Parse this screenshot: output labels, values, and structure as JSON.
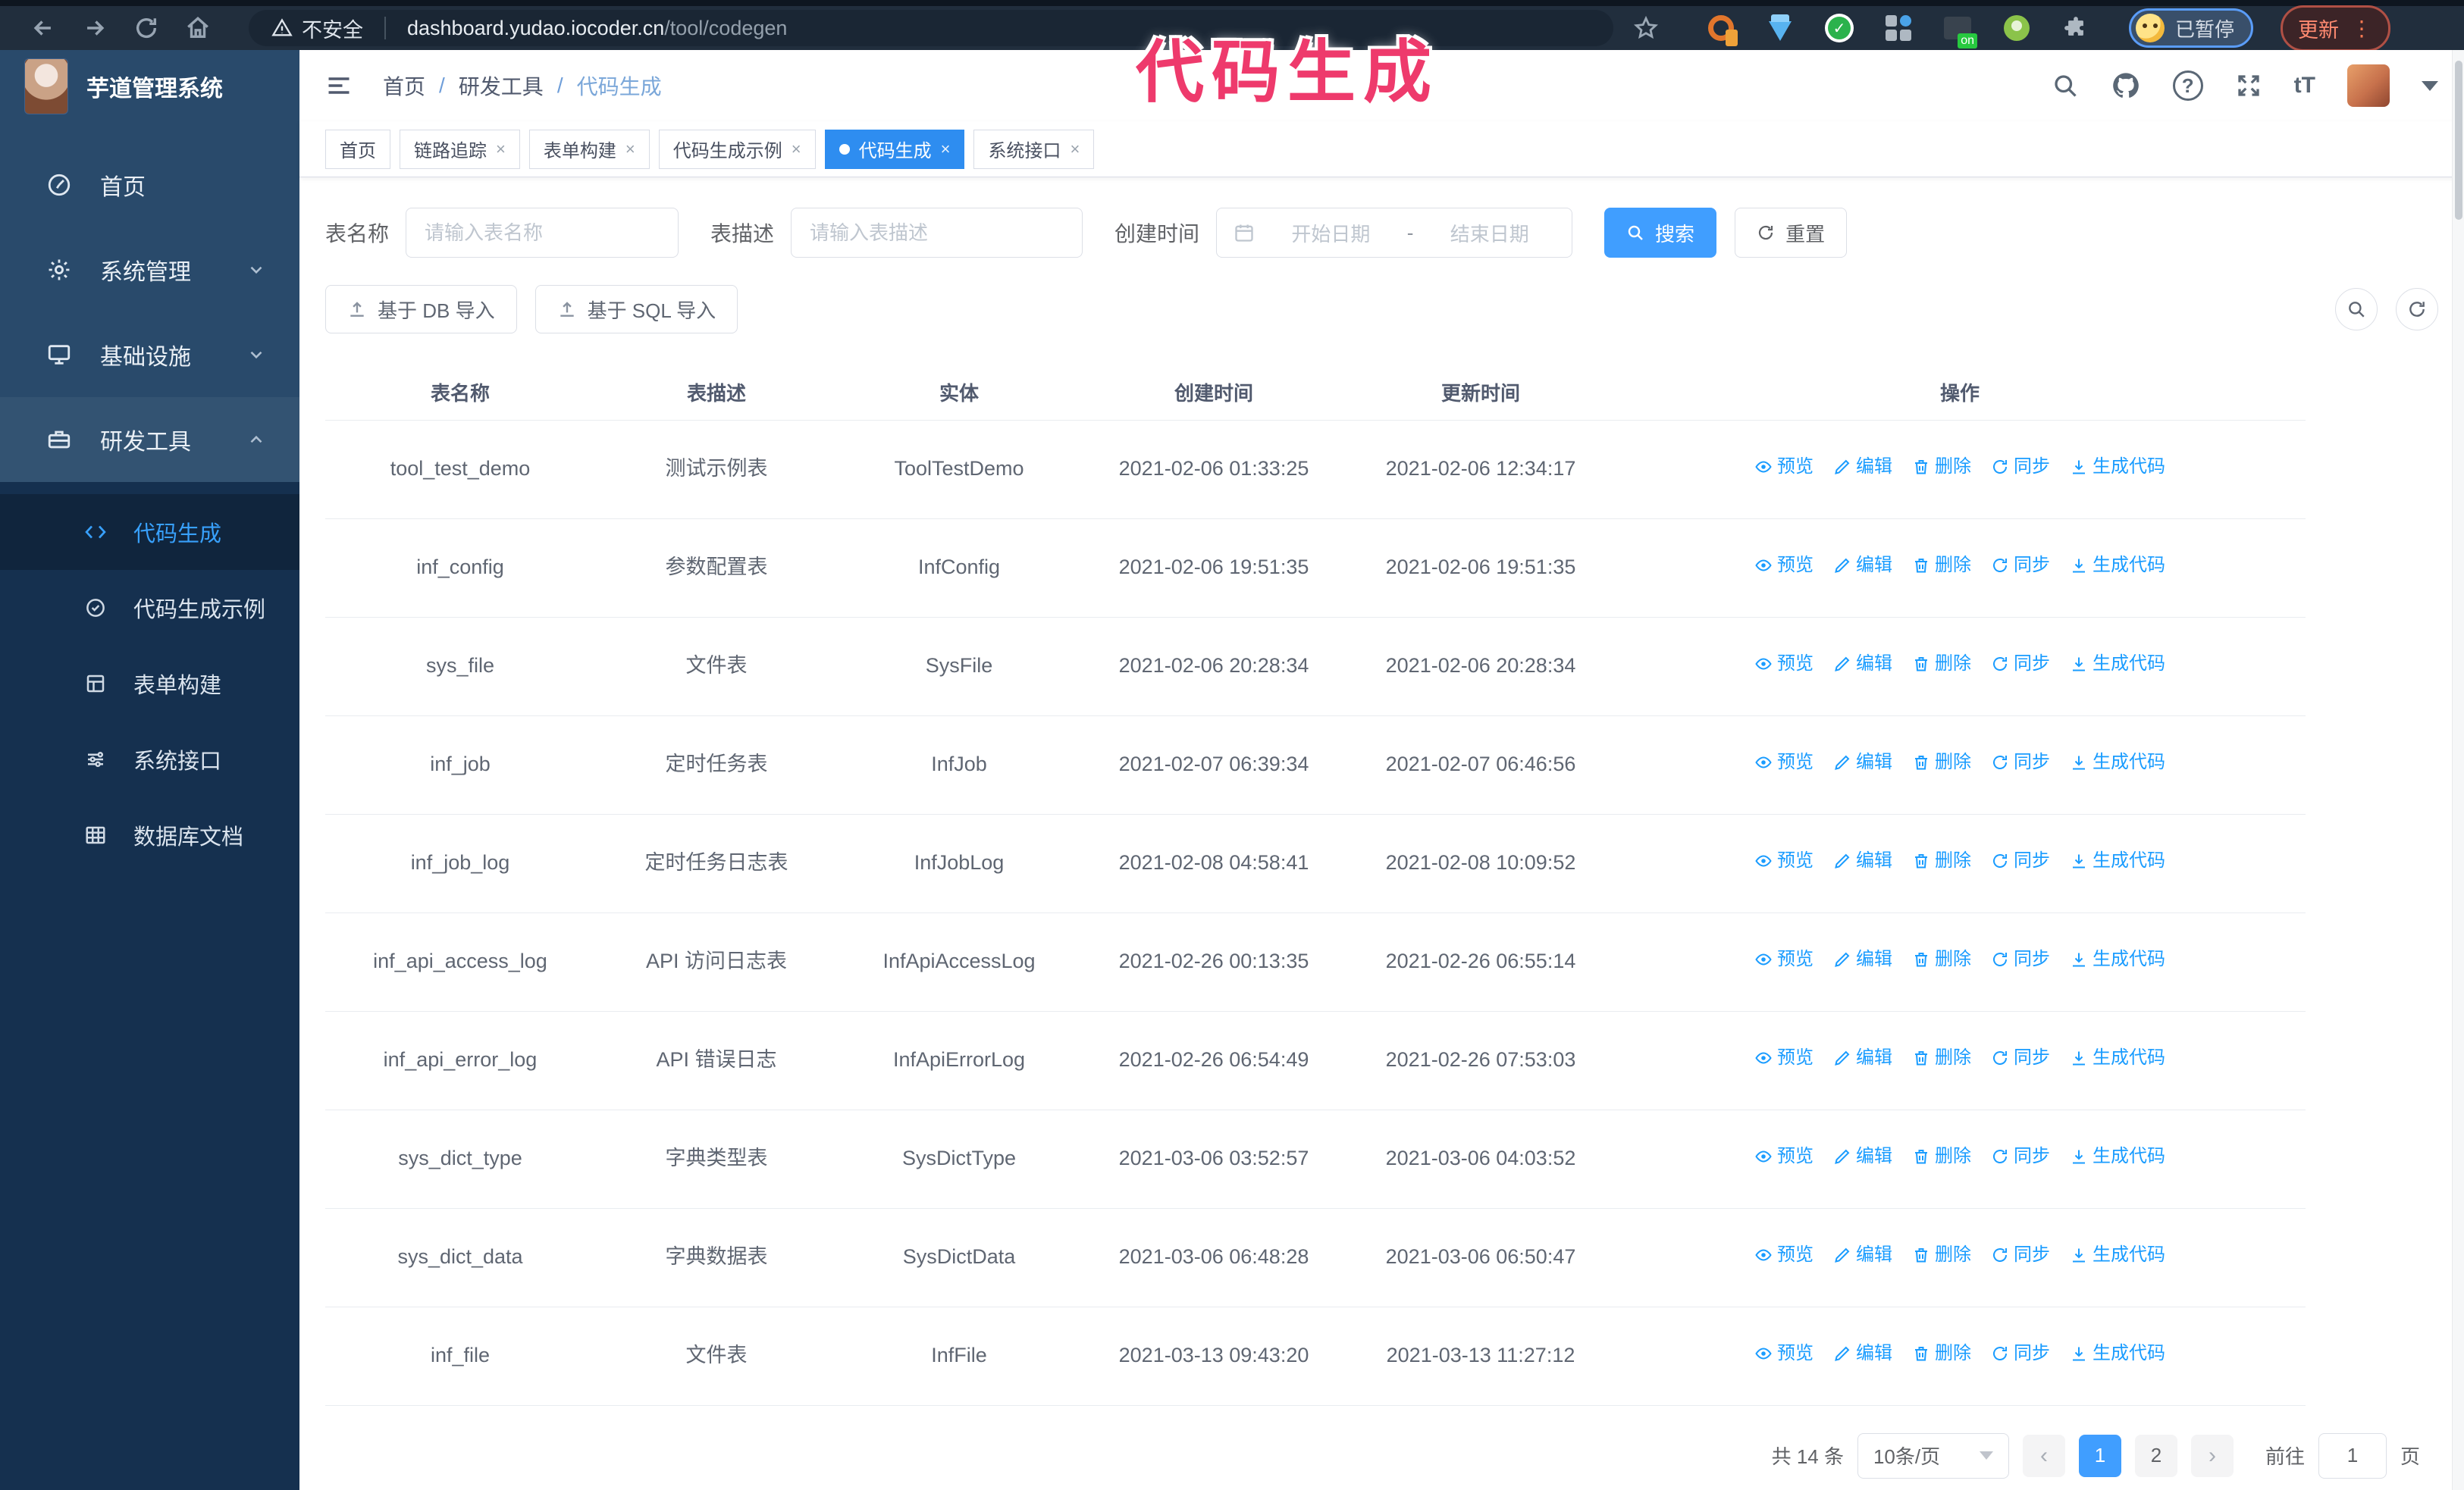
{
  "browser": {
    "security_warning": "不安全",
    "url_host": "dashboard.yudao.iocoder.cn",
    "url_path": "/tool/codegen",
    "extension_on_badge": "on",
    "profile_status": "已暂停",
    "update_label": "更新"
  },
  "annotation": {
    "text": "代码生成",
    "color": "#ee3a6c"
  },
  "sidebar": {
    "app_title": "芋道管理系统",
    "items": [
      {
        "label": "首页"
      },
      {
        "label": "系统管理"
      },
      {
        "label": "基础设施"
      },
      {
        "label": "研发工具"
      }
    ],
    "submenu": [
      {
        "label": "代码生成"
      },
      {
        "label": "代码生成示例"
      },
      {
        "label": "表单构建"
      },
      {
        "label": "系统接口"
      },
      {
        "label": "数据库文档"
      }
    ]
  },
  "header": {
    "breadcrumb": [
      "首页",
      "研发工具",
      "代码生成"
    ],
    "separator": "/"
  },
  "tabs": [
    {
      "label": "首页"
    },
    {
      "label": "链路追踪"
    },
    {
      "label": "表单构建"
    },
    {
      "label": "代码生成示例"
    },
    {
      "label": "代码生成"
    },
    {
      "label": "系统接口"
    }
  ],
  "filters": {
    "table_name_label": "表名称",
    "table_name_placeholder": "请输入表名称",
    "table_desc_label": "表描述",
    "table_desc_placeholder": "请输入表描述",
    "create_time_label": "创建时间",
    "date_start_placeholder": "开始日期",
    "date_separator": "-",
    "date_end_placeholder": "结束日期",
    "search_label": "搜索",
    "reset_label": "重置"
  },
  "toolbar": {
    "import_db_label": "基于 DB 导入",
    "import_sql_label": "基于 SQL 导入"
  },
  "table": {
    "columns": [
      "表名称",
      "表描述",
      "实体",
      "创建时间",
      "更新时间",
      "操作"
    ],
    "actions": [
      {
        "label": "预览",
        "icon": "eye-icon",
        "name": "preview"
      },
      {
        "label": "编辑",
        "icon": "edit-icon",
        "name": "edit"
      },
      {
        "label": "删除",
        "icon": "delete-icon",
        "name": "delete"
      },
      {
        "label": "同步",
        "icon": "sync-icon",
        "name": "sync"
      },
      {
        "label": "生成代码",
        "icon": "download-icon",
        "name": "generate-code"
      }
    ],
    "rows": [
      [
        "tool_test_demo",
        "测试示例表",
        "ToolTestDemo",
        "2021-02-06 01:33:25",
        "2021-02-06 12:34:17"
      ],
      [
        "inf_config",
        "参数配置表",
        "InfConfig",
        "2021-02-06 19:51:35",
        "2021-02-06 19:51:35"
      ],
      [
        "sys_file",
        "文件表",
        "SysFile",
        "2021-02-06 20:28:34",
        "2021-02-06 20:28:34"
      ],
      [
        "inf_job",
        "定时任务表",
        "InfJob",
        "2021-02-07 06:39:34",
        "2021-02-07 06:46:56"
      ],
      [
        "inf_job_log",
        "定时任务日志表",
        "InfJobLog",
        "2021-02-08 04:58:41",
        "2021-02-08 10:09:52"
      ],
      [
        "inf_api_access_log",
        "API 访问日志表",
        "InfApiAccessLog",
        "2021-02-26 00:13:35",
        "2021-02-26 06:55:14"
      ],
      [
        "inf_api_error_log",
        "API 错误日志",
        "InfApiErrorLog",
        "2021-02-26 06:54:49",
        "2021-02-26 07:53:03"
      ],
      [
        "sys_dict_type",
        "字典类型表",
        "SysDictType",
        "2021-03-06 03:52:57",
        "2021-03-06 04:03:52"
      ],
      [
        "sys_dict_data",
        "字典数据表",
        "SysDictData",
        "2021-03-06 06:48:28",
        "2021-03-06 06:50:47"
      ],
      [
        "inf_file",
        "文件表",
        "InfFile",
        "2021-03-13 09:43:20",
        "2021-03-13 11:27:12"
      ]
    ]
  },
  "pagination": {
    "total_label": "共 14 条",
    "page_size_label": "10条/页",
    "pages": [
      "1",
      "2"
    ],
    "active_page": "1",
    "prev_glyph": "‹",
    "next_glyph": "›",
    "goto_label": "前往",
    "goto_value": "1",
    "goto_suffix": "页"
  },
  "colors": {
    "primary": "#409eff",
    "link": "#1a9cff",
    "active_tab": "#2e8df0",
    "sidebar_top": "#294a6b",
    "sidebar_submenu": "#15304f",
    "browser_bar": "#212e3d",
    "annotation": "#ee3a6c"
  }
}
